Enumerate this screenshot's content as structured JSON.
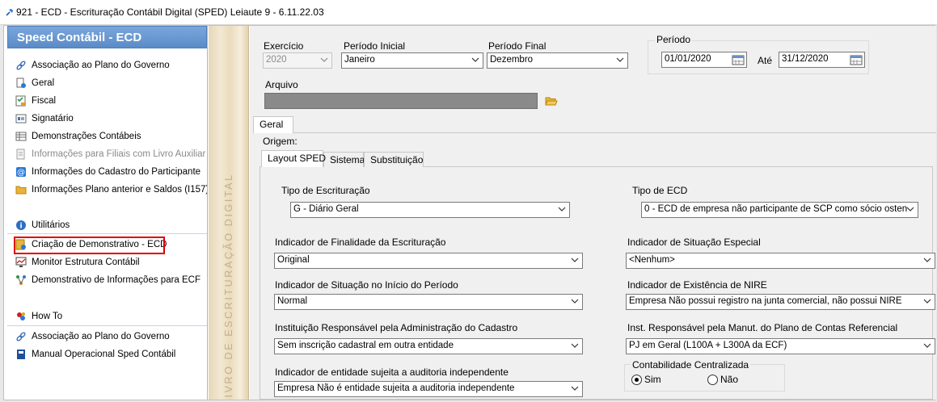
{
  "window": {
    "title": "921 - ECD - Escrituração Contábil Digital (SPED)  Leiaute 9 - 6.11.22.03"
  },
  "sidebar": {
    "header": "Speed Contábil - ECD",
    "group1": [
      {
        "label": "Associação ao Plano do Governo",
        "icon": "link-icon"
      },
      {
        "label": "Geral",
        "icon": "document-icon"
      },
      {
        "label": "Fiscal",
        "icon": "checklist-icon"
      },
      {
        "label": "Signatário",
        "icon": "signature-icon"
      },
      {
        "label": "Demonstrações Contábeis",
        "icon": "table-icon"
      },
      {
        "label": "Informações para Filiais com Livro Auxiliar",
        "icon": "document-gray-icon",
        "disabled": true
      },
      {
        "label": "Informações do Cadastro do Participante",
        "icon": "at-sign-icon"
      },
      {
        "label": "Informações Plano anterior e Saldos (I157)",
        "icon": "folder-icon"
      }
    ],
    "utilities_header": "Utilitários",
    "group2": [
      {
        "label": "Criação de Demonstrativo - ECD",
        "icon": "report-icon",
        "highlighted": true
      },
      {
        "label": "Monitor Estrutura Contábil",
        "icon": "monitor-icon"
      },
      {
        "label": "Demonstrativo de Informações para ECF",
        "icon": "network-icon"
      }
    ],
    "howto_header": "How To",
    "group3": [
      {
        "label": "Associação ao Plano do Governo",
        "icon": "link-icon"
      },
      {
        "label": "Manual Operacional Sped Contábil",
        "icon": "book-icon"
      }
    ]
  },
  "decorative_strip_text": "LIVRO DE ESCRITURAÇÃO DIGITAL",
  "form": {
    "exercicio": {
      "label": "Exercício",
      "value": "2020"
    },
    "periodo_inicial": {
      "label": "Período Inicial",
      "value": "Janeiro"
    },
    "periodo_final": {
      "label": "Período Final",
      "value": "Dezembro"
    },
    "periodo": {
      "label": "Período",
      "start": "01/01/2020",
      "ate_label": "Até",
      "end": "31/12/2020"
    },
    "arquivo": {
      "label": "Arquivo",
      "value": ""
    }
  },
  "tabs": {
    "geral": "Geral",
    "origem_label": "Origem:",
    "layout_sped": "Layout SPED",
    "sistema": "Sistema",
    "substituicao": "Substituição"
  },
  "fields": {
    "tipo_escrituracao": {
      "label": "Tipo de Escrituração",
      "value": "G - Diário Geral"
    },
    "tipo_ecd": {
      "label": "Tipo de ECD",
      "value": "0 - ECD de empresa não participante de SCP como sócio osten"
    },
    "ind_finalidade": {
      "label": "Indicador de Finalidade da Escrituração",
      "value": "Original"
    },
    "ind_situacao_especial": {
      "label": "Indicador de Situação Especial",
      "value": "<Nenhum>"
    },
    "ind_situacao_inicio": {
      "label": "Indicador de Situação no Início do Período",
      "value": "Normal"
    },
    "ind_existencia_nire": {
      "label": "Indicador de Existência de NIRE",
      "value": "Empresa Não possui registro na junta comercial, não possui NIRE"
    },
    "instituicao_cadastro": {
      "label": "Instituição Responsável pela Administração do Cadastro",
      "value": "Sem inscrição cadastral em outra entidade"
    },
    "inst_plano_contas": {
      "label": "Inst. Responsável pela Manut. do Plano de Contas Referencial",
      "value": "PJ em Geral (L100A + L300A da ECF)"
    },
    "ind_auditoria": {
      "label": "Indicador de entidade sujeita a auditoria independente",
      "value": "Empresa Não é entidade sujeita a auditoria independente"
    },
    "contabilidade_centralizada": {
      "label": "Contabilidade Centralizada",
      "sim": "Sim",
      "nao": "Não",
      "selected": "Sim"
    }
  },
  "colors": {
    "sidebar_header": "#6b98d2",
    "highlight": "#e00000"
  }
}
